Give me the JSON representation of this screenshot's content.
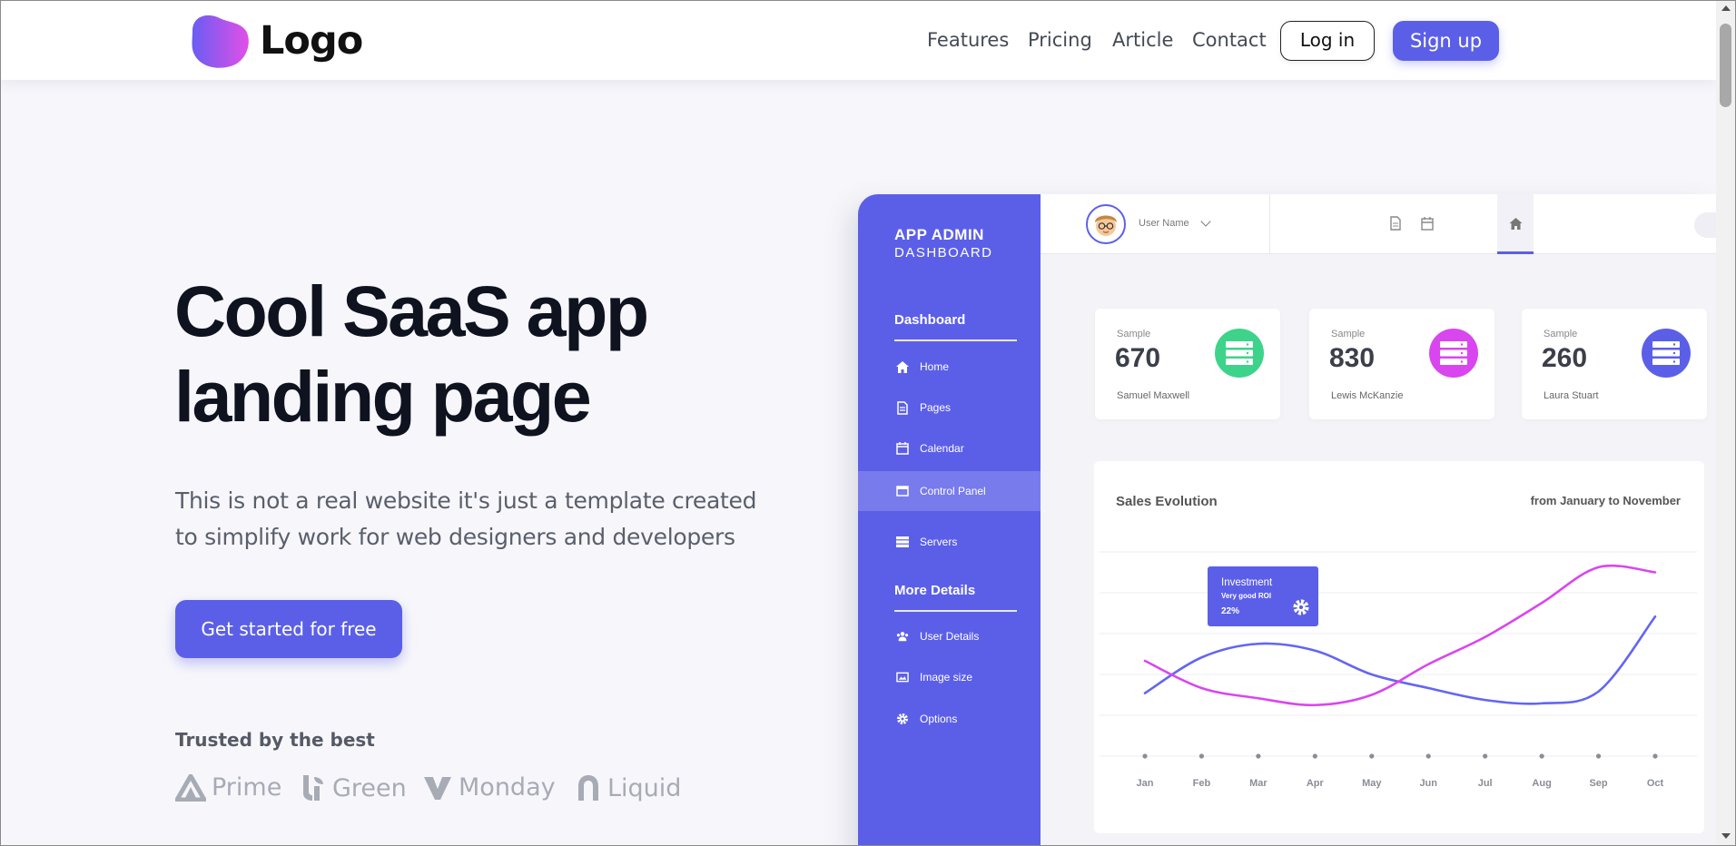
{
  "header": {
    "logo_text": "Logo",
    "nav": [
      "Features",
      "Pricing",
      "Article",
      "Contact"
    ],
    "login_label": "Log in",
    "signup_label": "Sign up"
  },
  "hero": {
    "title_lines": [
      "Cool SaaS app",
      "landing page"
    ],
    "subtitle_lines": [
      "This is not a real website it's just a template created",
      "to simplify work for web designers and developers"
    ],
    "cta_label": "Get started for free",
    "trusted_label": "Trusted by the best",
    "brands": [
      "Prime",
      "Green",
      "Monday",
      "Liquid"
    ]
  },
  "dashboard": {
    "brand_line1": "APP ADMIN",
    "brand_line2": "DASHBOARD",
    "section1": "Dashboard",
    "section2": "More Details",
    "menu1": [
      {
        "label": "Home",
        "icon": "home-icon"
      },
      {
        "label": "Pages",
        "icon": "page-icon"
      },
      {
        "label": "Calendar",
        "icon": "calendar-icon"
      },
      {
        "label": "Control Panel",
        "icon": "window-icon"
      },
      {
        "label": "Servers",
        "icon": "server-icon"
      }
    ],
    "menu2": [
      {
        "label": "User Details",
        "icon": "users-icon"
      },
      {
        "label": "Image size",
        "icon": "image-icon"
      },
      {
        "label": "Options",
        "icon": "gear-icon"
      }
    ],
    "user_name": "User Name",
    "stats": [
      {
        "label": "Sample",
        "value": "670",
        "person": "Samuel Maxwell",
        "color": "#3ed38a"
      },
      {
        "label": "Sample",
        "value": "830",
        "person": "Lewis McKanzie",
        "color": "#d946ef"
      },
      {
        "label": "Sample",
        "value": "260",
        "person": "Laura Stuart",
        "color": "#5b5fe8"
      }
    ],
    "chart_title": "Sales Evolution",
    "chart_range": "from January to November",
    "tooltip": {
      "title": "Investment",
      "sub": "Very good ROI",
      "value": "22%"
    }
  },
  "chart_data": {
    "type": "line",
    "x": [
      "Jan",
      "Feb",
      "Mar",
      "Apr",
      "May",
      "Jun",
      "Jul",
      "Aug",
      "Sep",
      "Oct"
    ],
    "series": [
      {
        "color": "#6366f1",
        "values": [
          37,
          58,
          66,
          62,
          48,
          40,
          33,
          31,
          38,
          82
        ]
      },
      {
        "color": "#d946ef",
        "values": [
          56,
          40,
          34,
          30,
          36,
          54,
          70,
          90,
          111,
          108
        ]
      }
    ],
    "ylim": [
      0,
      120
    ],
    "grid": true,
    "title": "Sales Evolution"
  },
  "colors": {
    "accent": "#5b5fe8",
    "green": "#3ed38a",
    "magenta": "#d946ef"
  }
}
